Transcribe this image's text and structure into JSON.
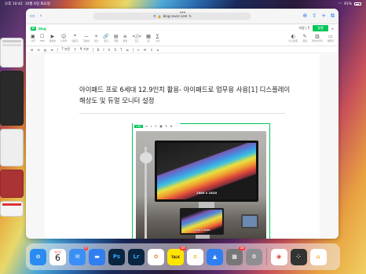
{
  "status": {
    "time": "오후 10:42",
    "date": "10월 6일 화요일",
    "battery": "91%"
  },
  "browser": {
    "url": "blog.naver.com",
    "aa_label": "가"
  },
  "editor": {
    "logo": "N",
    "blog_name": "blog",
    "save_label": "저장",
    "save_count": "5",
    "publish_label": "발행"
  },
  "toolbar": {
    "tools": [
      {
        "icon": "▣",
        "label": "사진"
      },
      {
        "icon": "☐",
        "label": "SNS"
      },
      {
        "icon": "▶",
        "label": "동영상"
      },
      {
        "icon": "☺",
        "label": "스티커"
      },
      {
        "icon": "❝",
        "label": "인용구"
      },
      {
        "icon": "—",
        "label": "구분선"
      },
      {
        "icon": "⌖",
        "label": "장소"
      },
      {
        "icon": "🔗",
        "label": "링크"
      },
      {
        "icon": "▤",
        "label": "파일"
      },
      {
        "icon": "≡",
        "label": "일정"
      },
      {
        "icon": "</>",
        "label": "코드"
      },
      {
        "icon": "▦",
        "label": "표"
      },
      {
        "icon": "∑",
        "label": "수식"
      }
    ],
    "right_tools": [
      {
        "icon": "◐",
        "label": "내 모먼트"
      },
      {
        "icon": "✎",
        "label": "글감"
      },
      {
        "icon": "▥",
        "label": "라이브러리"
      },
      {
        "icon": "▭",
        "label": "템플릿"
      }
    ]
  },
  "fmtbar": {
    "items": [
      "⊞",
      "⊟",
      "▤",
      "⊕",
      "T 본문",
      "T",
      "¶ 기본",
      "B",
      "I",
      "U",
      "S",
      "T",
      "⇆",
      "≡",
      "☰",
      "⇕",
      "𝒙"
    ]
  },
  "document": {
    "title": "아이패드 프로 6세대 12.9인치 활용- 아이패드로 업무용 사용[1] 디스플레이 해상도 및 듀얼 모니터 설정"
  },
  "image": {
    "tag": "<ID",
    "tools": [
      "▭",
      "⌕",
      "✂",
      "▣",
      "✎",
      "⊕",
      "⋯"
    ],
    "monitor_caption": "2880 x 1620",
    "ipad_caption": "2732 x 2048"
  },
  "dock": {
    "calendar_day": "월요일",
    "calendar_date": "6",
    "apps": [
      {
        "name": "safari",
        "color": "#2a8cf0",
        "glyph": "⊘"
      },
      {
        "name": "calendar"
      },
      {
        "name": "mail",
        "color": "#3a8ef5",
        "glyph": "✉",
        "badge": "3"
      },
      {
        "name": "files",
        "color": "#2f7ff0",
        "glyph": "▬"
      },
      {
        "name": "photoshop",
        "color": "#0a2540",
        "glyph": "Ps",
        "text": "#31a8ff"
      },
      {
        "name": "lightroom",
        "color": "#0a2540",
        "glyph": "Lr",
        "text": "#31a8ff"
      },
      {
        "name": "photos",
        "color": "#ffffff",
        "glyph": "✿",
        "text": "#e84"
      },
      {
        "name": "kakaotalk",
        "color": "#fee500",
        "glyph": "TALK",
        "text": "#3a1d1d",
        "badge": "47"
      },
      {
        "name": "notes",
        "color": "#fefefe",
        "glyph": "≡",
        "text": "#e8c030"
      },
      {
        "name": "keynote",
        "color": "#2f7ff0",
        "glyph": "▲"
      },
      {
        "name": "app-library",
        "color": "#777",
        "glyph": "▦",
        "badge": "19"
      },
      {
        "name": "settings",
        "color": "#8e8e93",
        "glyph": "⚙"
      },
      {
        "name": "chrome",
        "color": "#ffffff",
        "glyph": "◉",
        "text": "#db4437"
      },
      {
        "name": "multi-app",
        "color": "#333",
        "glyph": "⁘"
      },
      {
        "name": "home",
        "color": "#ffffff",
        "glyph": "⌂",
        "text": "#f5a623"
      }
    ]
  }
}
